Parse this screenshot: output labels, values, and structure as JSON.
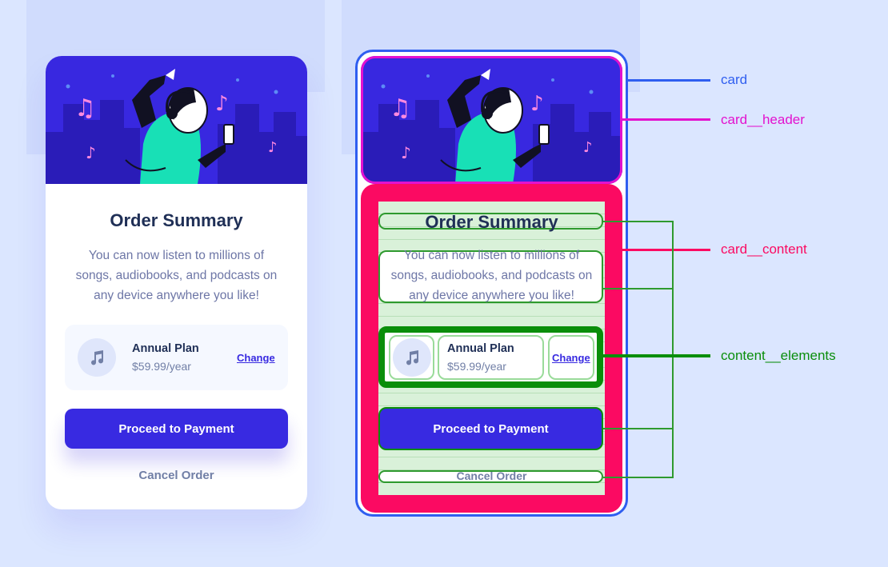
{
  "card": {
    "title": "Order Summary",
    "description_lines": [
      "You can now listen to millions of",
      "songs, audiobooks, and podcasts on",
      "any device anywhere you like!"
    ],
    "plan": {
      "name": "Annual Plan",
      "price": "$59.99/year",
      "change_label": "Change",
      "icon": "music-note-icon"
    },
    "pay_button": "Proceed to Payment",
    "cancel_button": "Cancel Order"
  },
  "annotations": {
    "card": "card",
    "card_header": "card__header",
    "card_content": "card__content",
    "content_elements": "content__elements"
  },
  "colors": {
    "background": "#dbe6ff",
    "primary": "#382ae1",
    "title": "#1f2f56",
    "text_muted": "#717fa6",
    "header_bg": "#3828e0",
    "annotation_card": "#2f5ef0",
    "annotation_header": "#e312cf",
    "annotation_content": "#fb0a62",
    "annotation_elements": "#0a8e0a"
  }
}
